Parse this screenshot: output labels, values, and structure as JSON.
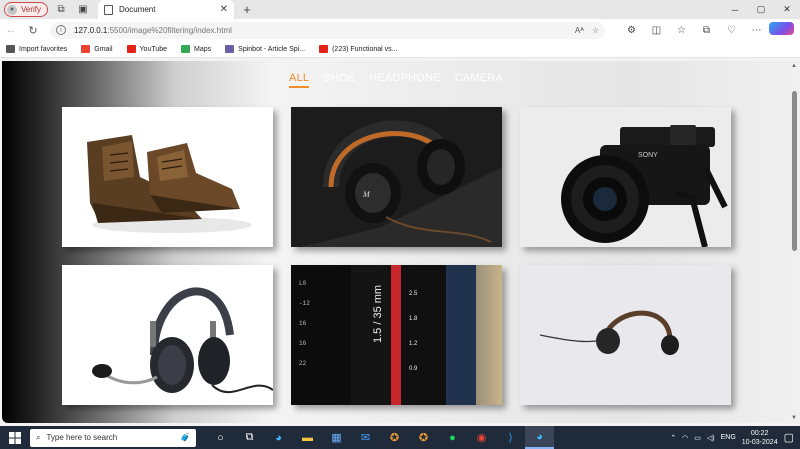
{
  "browser": {
    "profile_label": "Verify",
    "tab_title": "Document",
    "new_tab": "+",
    "window_controls": [
      "─",
      "▢",
      "✕"
    ],
    "url_host": "127.0.0.1",
    "url_rest": ":5500/image%20filtering/index.html",
    "read_aloud": "Aᴬ",
    "bookmarks": [
      {
        "label": "Import favorites",
        "icon": "import-favorites-icon",
        "color": "#555555"
      },
      {
        "label": "Gmail",
        "icon": "gmail-icon",
        "color": "#ea4335"
      },
      {
        "label": "YouTube",
        "icon": "youtube-icon",
        "color": "#e62117"
      },
      {
        "label": "Maps",
        "icon": "maps-icon",
        "color": "#34a853"
      },
      {
        "label": "Spinbot - Article Spi...",
        "icon": "spinbot-icon",
        "color": "#6b5fa6"
      },
      {
        "label": "(223) Functional vs...",
        "icon": "youtube-icon",
        "color": "#e62117"
      }
    ]
  },
  "page": {
    "filters": [
      {
        "label": "ALL",
        "active": true
      },
      {
        "label": "SHOE",
        "active": false
      },
      {
        "label": "HEADPHONE",
        "active": false
      },
      {
        "label": "CAMERA",
        "active": false
      }
    ],
    "accent_color": "#f08c2b",
    "gallery": [
      {
        "name": "boots-image",
        "category": "shoe"
      },
      {
        "name": "headphone-marshall-image",
        "category": "headphone"
      },
      {
        "name": "camera-sony-image",
        "category": "camera"
      },
      {
        "name": "headset-mic-image",
        "category": "headphone"
      },
      {
        "name": "camera-lens-image",
        "category": "camera",
        "lens_label": "1.5 / 35 mm"
      },
      {
        "name": "headphone-white-bg-image",
        "category": "headphone"
      }
    ]
  },
  "taskbar": {
    "search_placeholder": "Type here to search",
    "language": "ENG",
    "time": "00:22",
    "date": "10-03-2024"
  }
}
